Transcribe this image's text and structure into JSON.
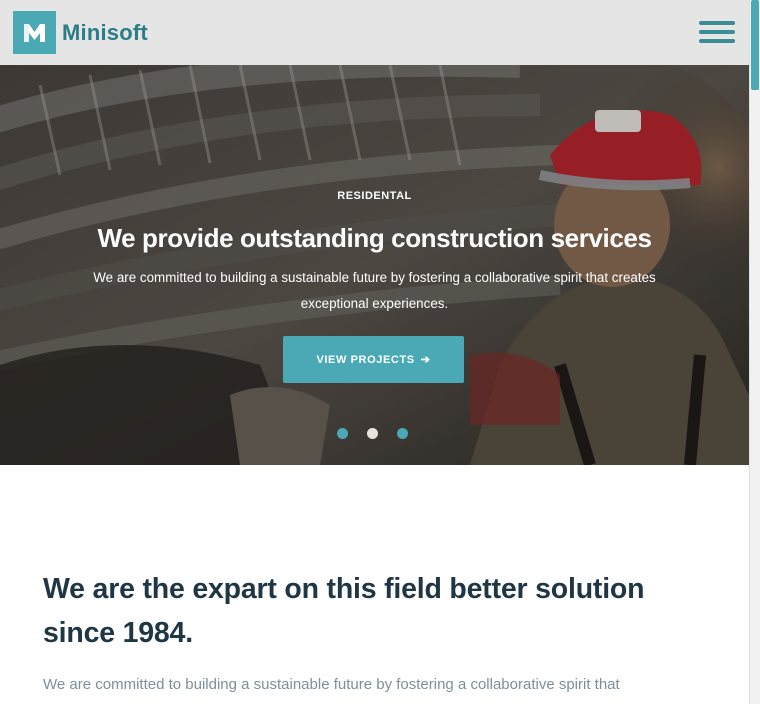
{
  "header": {
    "brand": "Minisoft",
    "logo_icon": "m-logo-icon",
    "menu_icon": "hamburger-menu-icon"
  },
  "hero": {
    "eyebrow": "RESIDENTAL",
    "title": "We provide outstanding construction services",
    "description": "We are committed to building a sustainable future by fostering a collaborative spirit that creates exceptional experiences.",
    "cta_label": "VIEW PROJECTS",
    "cta_icon": "arrow-right-icon",
    "slides": [
      {
        "active": false
      },
      {
        "active": true
      },
      {
        "active": false
      }
    ]
  },
  "intro": {
    "title": "We are the expart on this field better solution since 1984.",
    "text": "We are committed to building a sustainable future by fostering a collaborative spirit that"
  },
  "colors": {
    "accent": "#4aa9b5",
    "brand_text": "#2b7d87",
    "heading": "#1f3645",
    "body_text": "#7d8f9c",
    "header_bg": "#e5e5e5"
  }
}
